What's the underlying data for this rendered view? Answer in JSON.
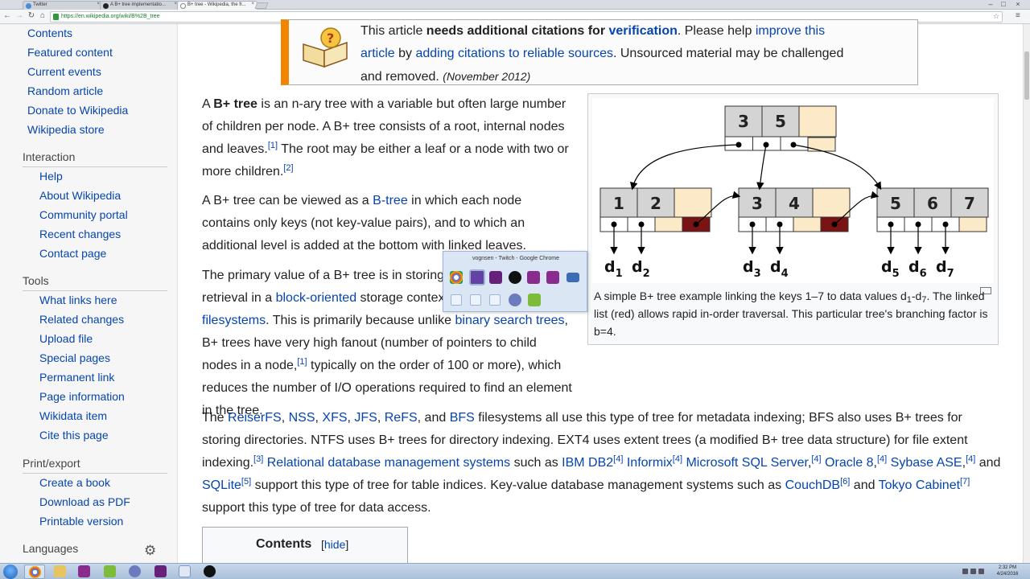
{
  "browser": {
    "tabs": [
      {
        "label": "Twitter"
      },
      {
        "label": "A B+ tree implementatio..."
      },
      {
        "label": "B+ tree - Wikipedia, the fr..."
      }
    ],
    "url": "https://en.wikipedia.org/wiki/B%2B_tree"
  },
  "sidebar": {
    "navigation": [
      "Contents",
      "Featured content",
      "Current events",
      "Random article",
      "Donate to Wikipedia",
      "Wikipedia store"
    ],
    "interaction_heading": "Interaction",
    "interaction": [
      "Help",
      "About Wikipedia",
      "Community portal",
      "Recent changes",
      "Contact page"
    ],
    "tools_heading": "Tools",
    "tools": [
      "What links here",
      "Related changes",
      "Upload file",
      "Special pages",
      "Permanent link",
      "Page information",
      "Wikidata item",
      "Cite this page"
    ],
    "print_heading": "Print/export",
    "print": [
      "Create a book",
      "Download as PDF",
      "Printable version"
    ],
    "languages_heading": "Languages"
  },
  "ambox": {
    "line1_pre": "This article ",
    "line1_bold": "needs additional citations for ",
    "line1_link": "verification",
    "line1_mid": ". Please help ",
    "line1_link2": "improve this",
    "line2_link": "article",
    "line2_mid": " by ",
    "line2_link2": "adding citations to reliable sources",
    "line2_post": ". Unsourced material may be challenged",
    "line3": "and removed.",
    "date": "(November 2012)"
  },
  "article": {
    "p1": {
      "a": "A ",
      "bold": "B+ tree",
      "b": " is an n-ary tree with a variable but often large number of children per node. A B+ tree consists of a root, internal nodes and leaves.",
      "ref1": "[1]",
      "c": " The root may be either a leaf or a node with two or more children.",
      "ref2": "[2]"
    },
    "p2": {
      "a": "A B+ tree can be viewed as a ",
      "link": "B-tree",
      "b": " in which each node contains only keys (not key-value pairs), and to which an additional level is added at the bottom with linked leaves."
    },
    "p3": {
      "a": "The primary value of a B+ tree is in storing data for efficient retrieval in a ",
      "link1": "block-oriented",
      "b": " storage context — in particular, ",
      "link2": "filesystems",
      "c": ". This is primarily because unlike ",
      "link3": "binary search trees",
      "d": ", B+ trees have very high fanout (number of pointers to child nodes in a node,",
      "ref": "[1]",
      "e": " typically on the order of 100 or more), which reduces the number of I/O operations required to find an element in the tree."
    },
    "p4": {
      "a": "The ",
      "reiserfs": "ReiserFS",
      "c1": ", ",
      "nss": "NSS",
      "c2": ", ",
      "xfs": "XFS",
      "c3": ", ",
      "jfs": "JFS",
      "c4": ", ",
      "refs": "ReFS",
      "c5": ", and ",
      "bfs": "BFS",
      "b": " filesystems all use this type of tree for metadata indexing; BFS also uses B+ trees for storing directories. NTFS uses B+ trees for directory indexing. EXT4 uses extent trees (a modified B+ tree data structure) for file extent indexing.",
      "ref3": "[3]",
      "sp": " ",
      "rdbms": "Relational database management systems",
      "such": " such as ",
      "db2": "IBM DB2",
      "ref4a": "[4]",
      "sp2": " ",
      "informix": "Informix",
      "ref4b": "[4]",
      "sp3": " ",
      "mssql": "Microsoft SQL Server",
      "comma1": ",",
      "ref4c": "[4]",
      "sp4": " ",
      "oracle": "Oracle 8",
      "comma2": ",",
      "ref4d": "[4]",
      "sp5": " ",
      "sybase": "Sybase ASE",
      "comma3": ",",
      "ref4e": "[4]",
      "and": " and ",
      "sqlite": "SQLite",
      "ref5": "[5]",
      "c": " support this type of tree for table indices. Key-value database management systems such as ",
      "couchdb": "CouchDB",
      "ref6": "[6]",
      "and2": " and ",
      "tokyo": "Tokyo Cabinet",
      "ref7": "[7]",
      "d": " support this type of tree for data access."
    },
    "toc_title": "Contents",
    "toc_hide": "[hide]"
  },
  "figure": {
    "root_keys": [
      "3",
      "5"
    ],
    "leaves": [
      [
        "1",
        "2"
      ],
      [
        "3",
        "4"
      ],
      [
        "5",
        "6",
        "7"
      ]
    ],
    "data_labels": [
      "d1",
      "d2",
      "d3",
      "d4",
      "d5",
      "d6",
      "d7"
    ],
    "caption_a": "A simple B+ tree example linking the keys 1–7 to data values d",
    "caption_sub1": "1",
    "caption_dash": "-d",
    "caption_sub7": "7",
    "caption_b": ". The linked list (red) allows rapid in-order traversal. This particular tree's branching factor is b=4.",
    "colors": {
      "key_cell": "#d4d4d4",
      "empty_cell": "#fbe9c8",
      "link_cell": "#7a1414"
    }
  },
  "popup": {
    "title": "vognsen - Twitch - Google Chrome"
  },
  "taskbar": {
    "time": "2:32 PM",
    "date": "4/24/2016"
  }
}
